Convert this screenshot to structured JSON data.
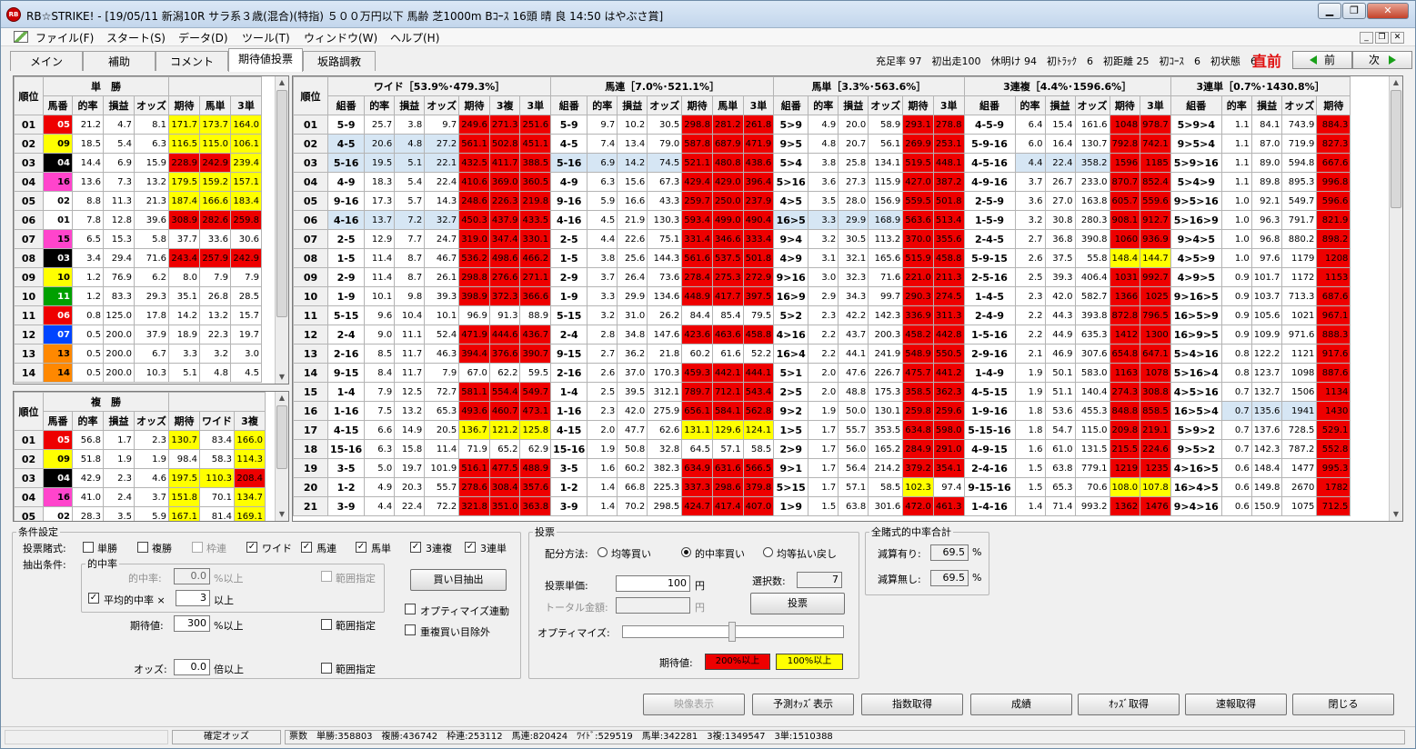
{
  "window": {
    "title": "RB☆STRIKE! - [19/05/11 新潟10R サラ系３歳(混合)(特指) ５００万円以下 馬齢 芝1000m Bｺｰｽ 16頭 晴 良 14:50 はやぶさ賞]",
    "app_icon": "RB",
    "minimize": "▁",
    "restore": "❐",
    "close": "✕"
  },
  "menu": [
    "ファイル(F)",
    "スタート(S)",
    "データ(D)",
    "ツール(T)",
    "ウィンドウ(W)",
    "ヘルプ(H)"
  ],
  "mdi": {
    "minimize": "_",
    "restore": "❐",
    "close": "✕"
  },
  "tabs": [
    "メイン",
    "補助",
    "コメント",
    "期待値投票",
    "坂路調教"
  ],
  "stats": "充足率 97　初出走100　休明け 94　初ﾄﾗｯｸ　6　初距離 25　初ｺｰｽ　6　初状態　6",
  "chokuzen": "直前",
  "prev": "前",
  "next": "次",
  "rank_label": "順位",
  "tansho": {
    "title": "単　勝",
    "cols": [
      "馬番",
      "的率",
      "損益",
      "オッズ",
      "期待",
      "馬単",
      "3単"
    ],
    "rows": [
      [
        "01",
        "05",
        "21.2",
        "4.7",
        "8.1",
        "171.7",
        "173.7",
        "164.0",
        "yyy"
      ],
      [
        "02",
        "09",
        "18.5",
        "5.4",
        "6.3",
        "116.5",
        "115.0",
        "106.1",
        "yyy"
      ],
      [
        "03",
        "04",
        "14.4",
        "6.9",
        "15.9",
        "228.9",
        "242.9",
        "239.4",
        "rry"
      ],
      [
        "04",
        "16",
        "13.6",
        "7.3",
        "13.2",
        "179.5",
        "159.2",
        "157.1",
        "yyy"
      ],
      [
        "05",
        "02",
        "8.8",
        "11.3",
        "21.3",
        "187.4",
        "166.6",
        "183.4",
        "yyy"
      ],
      [
        "06",
        "01",
        "7.8",
        "12.8",
        "39.6",
        "308.9",
        "282.6",
        "259.8",
        "rrr"
      ],
      [
        "07",
        "15",
        "6.5",
        "15.3",
        "5.8",
        "37.7",
        "33.6",
        "30.6",
        "---"
      ],
      [
        "08",
        "03",
        "3.4",
        "29.4",
        "71.6",
        "243.4",
        "257.9",
        "242.9",
        "rrr"
      ],
      [
        "09",
        "10",
        "1.2",
        "76.9",
        "6.2",
        "8.0",
        "7.9",
        "7.9",
        "---"
      ],
      [
        "10",
        "11",
        "1.2",
        "83.3",
        "29.3",
        "35.1",
        "26.8",
        "28.5",
        "---"
      ],
      [
        "11",
        "06",
        "0.8",
        "125.0",
        "17.8",
        "14.2",
        "13.2",
        "15.7",
        "---"
      ],
      [
        "12",
        "07",
        "0.5",
        "200.0",
        "37.9",
        "18.9",
        "22.3",
        "19.7",
        "---"
      ],
      [
        "13",
        "13",
        "0.5",
        "200.0",
        "6.7",
        "3.3",
        "3.2",
        "3.0",
        "---"
      ],
      [
        "14",
        "14",
        "0.5",
        "200.0",
        "10.3",
        "5.1",
        "4.8",
        "4.5",
        "---"
      ]
    ]
  },
  "fukusho": {
    "title": "複　勝",
    "cols": [
      "馬番",
      "的率",
      "損益",
      "オッズ",
      "期待",
      "ワイド",
      "3複"
    ],
    "rows": [
      [
        "01",
        "05",
        "56.8",
        "1.7",
        "2.3",
        "130.7",
        "83.4",
        "166.0",
        "y-y"
      ],
      [
        "02",
        "09",
        "51.8",
        "1.9",
        "1.9",
        "98.4",
        "58.3",
        "114.3",
        "--y"
      ],
      [
        "03",
        "04",
        "42.9",
        "2.3",
        "4.6",
        "197.5",
        "110.3",
        "208.4",
        "yyr"
      ],
      [
        "04",
        "16",
        "41.0",
        "2.4",
        "3.7",
        "151.8",
        "70.1",
        "134.7",
        "y-y"
      ],
      [
        "05",
        "02",
        "28.3",
        "3.5",
        "5.9",
        "167.1",
        "81.4",
        "169.1",
        "y-y"
      ]
    ]
  },
  "right_grid": {
    "sections": [
      {
        "title": "ワイド［53.9%･479.3%］",
        "cols": [
          "組番",
          "的率",
          "損益",
          "オッズ",
          "期待",
          "3複",
          "3単"
        ]
      },
      {
        "title": "馬連［7.0%･521.1%］",
        "cols": [
          "組番",
          "的率",
          "損益",
          "オッズ",
          "期待",
          "馬単",
          "3単"
        ]
      },
      {
        "title": "馬単［3.3%･563.6%］",
        "cols": [
          "組番",
          "的率",
          "損益",
          "オッズ",
          "期待",
          "3単"
        ]
      },
      {
        "title": "3連複［4.4%･1596.6%］",
        "cols": [
          "組番",
          "的率",
          "損益",
          "オッズ",
          "期待",
          "3単"
        ]
      },
      {
        "title": "3連単［0.7%･1430.8%］",
        "cols": [
          "組番",
          "的率",
          "損益",
          "オッズ",
          "期待"
        ]
      }
    ],
    "rows": [
      [
        "01",
        "5-9",
        "25.7",
        "3.8",
        "9.7",
        "249.6",
        "271.3",
        "251.6",
        "5-9",
        "9.7",
        "10.2",
        "30.5",
        "298.8",
        "281.2",
        "261.8",
        "5>9",
        "4.9",
        "20.0",
        "58.9",
        "293.1",
        "278.8",
        "4-5-9",
        "6.4",
        "15.4",
        "161.6",
        "1048",
        "978.7",
        "5>9>4",
        "1.1",
        "84.1",
        "743.9",
        "884.3"
      ],
      [
        "02",
        "4-5",
        "20.6",
        "4.8",
        "27.2",
        "561.1",
        "502.8",
        "451.1",
        "4-5",
        "7.4",
        "13.4",
        "79.0",
        "587.8",
        "687.9",
        "471.9",
        "9>5",
        "4.8",
        "20.7",
        "56.1",
        "269.9",
        "253.1",
        "5-9-16",
        "6.0",
        "16.4",
        "130.7",
        "792.8",
        "742.1",
        "9>5>4",
        "1.1",
        "87.0",
        "719.9",
        "827.3"
      ],
      [
        "03",
        "5-16",
        "19.5",
        "5.1",
        "22.1",
        "432.5",
        "411.7",
        "388.5",
        "5-16",
        "6.9",
        "14.2",
        "74.5",
        "521.1",
        "480.8",
        "438.6",
        "5>4",
        "3.8",
        "25.8",
        "134.1",
        "519.5",
        "448.1",
        "4-5-16",
        "4.4",
        "22.4",
        "358.2",
        "1596",
        "1185",
        "5>9>16",
        "1.1",
        "89.0",
        "594.8",
        "667.6"
      ],
      [
        "04",
        "4-9",
        "18.3",
        "5.4",
        "22.4",
        "410.6",
        "369.0",
        "360.5",
        "4-9",
        "6.3",
        "15.6",
        "67.3",
        "429.4",
        "429.0",
        "396.4",
        "5>16",
        "3.6",
        "27.3",
        "115.9",
        "427.0",
        "387.2",
        "4-9-16",
        "3.7",
        "26.7",
        "233.0",
        "870.7",
        "852.4",
        "5>4>9",
        "1.1",
        "89.8",
        "895.3",
        "996.8"
      ],
      [
        "05",
        "9-16",
        "17.3",
        "5.7",
        "14.3",
        "248.6",
        "226.3",
        "219.8",
        "9-16",
        "5.9",
        "16.6",
        "43.3",
        "259.7",
        "250.0",
        "237.9",
        "4>5",
        "3.5",
        "28.0",
        "156.9",
        "559.5",
        "501.8",
        "2-5-9",
        "3.6",
        "27.0",
        "163.8",
        "605.7",
        "559.6",
        "9>5>16",
        "1.0",
        "92.1",
        "549.7",
        "596.6"
      ],
      [
        "06",
        "4-16",
        "13.7",
        "7.2",
        "32.7",
        "450.3",
        "437.9",
        "433.5",
        "4-16",
        "4.5",
        "21.9",
        "130.3",
        "593.4",
        "499.0",
        "490.4",
        "16>5",
        "3.3",
        "29.9",
        "168.9",
        "563.6",
        "513.4",
        "1-5-9",
        "3.2",
        "30.8",
        "280.3",
        "908.1",
        "912.7",
        "5>16>9",
        "1.0",
        "96.3",
        "791.7",
        "821.9"
      ],
      [
        "07",
        "2-5",
        "12.9",
        "7.7",
        "24.7",
        "319.0",
        "347.4",
        "330.1",
        "2-5",
        "4.4",
        "22.6",
        "75.1",
        "331.4",
        "346.6",
        "333.4",
        "9>4",
        "3.2",
        "30.5",
        "113.2",
        "370.0",
        "355.6",
        "2-4-5",
        "2.7",
        "36.8",
        "390.8",
        "1060",
        "936.9",
        "9>4>5",
        "1.0",
        "96.8",
        "880.2",
        "898.2"
      ],
      [
        "08",
        "1-5",
        "11.4",
        "8.7",
        "46.7",
        "536.2",
        "498.6",
        "466.2",
        "1-5",
        "3.8",
        "25.6",
        "144.3",
        "561.6",
        "537.5",
        "501.8",
        "4>9",
        "3.1",
        "32.1",
        "165.6",
        "515.9",
        "458.8",
        "5-9-15",
        "2.6",
        "37.5",
        "55.8",
        "148.4",
        "144.7",
        "4>5>9",
        "1.0",
        "97.6",
        "1179",
        "1208"
      ],
      [
        "09",
        "2-9",
        "11.4",
        "8.7",
        "26.1",
        "298.8",
        "276.6",
        "271.1",
        "2-9",
        "3.7",
        "26.4",
        "73.6",
        "278.4",
        "275.3",
        "272.9",
        "9>16",
        "3.0",
        "32.3",
        "71.6",
        "221.0",
        "211.3",
        "2-5-16",
        "2.5",
        "39.3",
        "406.4",
        "1031",
        "992.7",
        "4>9>5",
        "0.9",
        "101.7",
        "1172",
        "1153"
      ],
      [
        "10",
        "1-9",
        "10.1",
        "9.8",
        "39.3",
        "398.9",
        "372.3",
        "366.6",
        "1-9",
        "3.3",
        "29.9",
        "134.6",
        "448.9",
        "417.7",
        "397.5",
        "16>9",
        "2.9",
        "34.3",
        "99.7",
        "290.3",
        "274.5",
        "1-4-5",
        "2.3",
        "42.0",
        "582.7",
        "1366",
        "1025",
        "9>16>5",
        "0.9",
        "103.7",
        "713.3",
        "687.6"
      ],
      [
        "11",
        "5-15",
        "9.6",
        "10.4",
        "10.1",
        "96.9",
        "91.3",
        "88.9",
        "5-15",
        "3.2",
        "31.0",
        "26.2",
        "84.4",
        "85.4",
        "79.5",
        "5>2",
        "2.3",
        "42.2",
        "142.3",
        "336.9",
        "311.3",
        "2-4-9",
        "2.2",
        "44.3",
        "393.8",
        "872.8",
        "796.5",
        "16>5>9",
        "0.9",
        "105.6",
        "1021",
        "967.1"
      ],
      [
        "12",
        "2-4",
        "9.0",
        "11.1",
        "52.4",
        "471.9",
        "444.6",
        "436.7",
        "2-4",
        "2.8",
        "34.8",
        "147.6",
        "423.6",
        "463.6",
        "458.8",
        "4>16",
        "2.2",
        "43.7",
        "200.3",
        "458.2",
        "442.8",
        "1-5-16",
        "2.2",
        "44.9",
        "635.3",
        "1412",
        "1300",
        "16>9>5",
        "0.9",
        "109.9",
        "971.6",
        "888.3"
      ],
      [
        "13",
        "2-16",
        "8.5",
        "11.7",
        "46.3",
        "394.4",
        "376.6",
        "390.7",
        "9-15",
        "2.7",
        "36.2",
        "21.8",
        "60.2",
        "61.6",
        "52.2",
        "16>4",
        "2.2",
        "44.1",
        "241.9",
        "548.9",
        "550.5",
        "2-9-16",
        "2.1",
        "46.9",
        "307.6",
        "654.8",
        "647.1",
        "5>4>16",
        "0.8",
        "122.2",
        "1121",
        "917.6"
      ],
      [
        "14",
        "9-15",
        "8.4",
        "11.7",
        "7.9",
        "67.0",
        "62.2",
        "59.5",
        "2-16",
        "2.6",
        "37.0",
        "170.3",
        "459.3",
        "442.1",
        "444.1",
        "5>1",
        "2.0",
        "47.6",
        "226.7",
        "475.7",
        "441.2",
        "1-4-9",
        "1.9",
        "50.1",
        "583.0",
        "1163",
        "1078",
        "5>16>4",
        "0.8",
        "123.7",
        "1098",
        "887.6"
      ],
      [
        "15",
        "1-4",
        "7.9",
        "12.5",
        "72.7",
        "581.1",
        "554.4",
        "549.7",
        "1-4",
        "2.5",
        "39.5",
        "312.1",
        "789.7",
        "712.1",
        "543.4",
        "2>5",
        "2.0",
        "48.8",
        "175.3",
        "358.5",
        "362.3",
        "4-5-15",
        "1.9",
        "51.1",
        "140.4",
        "274.3",
        "308.8",
        "4>5>16",
        "0.7",
        "132.7",
        "1506",
        "1134"
      ],
      [
        "16",
        "1-16",
        "7.5",
        "13.2",
        "65.3",
        "493.6",
        "460.7",
        "473.1",
        "1-16",
        "2.3",
        "42.0",
        "275.9",
        "656.1",
        "584.1",
        "562.8",
        "9>2",
        "1.9",
        "50.0",
        "130.1",
        "259.8",
        "259.6",
        "1-9-16",
        "1.8",
        "53.6",
        "455.3",
        "848.8",
        "858.5",
        "16>5>4",
        "0.7",
        "135.6",
        "1941",
        "1430"
      ],
      [
        "17",
        "4-15",
        "6.6",
        "14.9",
        "20.5",
        "136.7",
        "121.2",
        "125.8",
        "4-15",
        "2.0",
        "47.7",
        "62.6",
        "131.1",
        "129.6",
        "124.1",
        "1>5",
        "1.7",
        "55.7",
        "353.5",
        "634.8",
        "598.0",
        "5-15-16",
        "1.8",
        "54.7",
        "115.0",
        "209.8",
        "219.1",
        "5>9>2",
        "0.7",
        "137.6",
        "728.5",
        "529.1"
      ],
      [
        "18",
        "15-16",
        "6.3",
        "15.8",
        "11.4",
        "71.9",
        "65.2",
        "62.9",
        "15-16",
        "1.9",
        "50.8",
        "32.8",
        "64.5",
        "57.1",
        "58.5",
        "2>9",
        "1.7",
        "56.0",
        "165.2",
        "284.9",
        "291.0",
        "4-9-15",
        "1.6",
        "61.0",
        "131.5",
        "215.5",
        "224.6",
        "9>5>2",
        "0.7",
        "142.3",
        "787.2",
        "552.8"
      ],
      [
        "19",
        "3-5",
        "5.0",
        "19.7",
        "101.9",
        "516.1",
        "477.5",
        "488.9",
        "3-5",
        "1.6",
        "60.2",
        "382.3",
        "634.9",
        "631.6",
        "566.5",
        "9>1",
        "1.7",
        "56.4",
        "214.2",
        "379.2",
        "354.1",
        "2-4-16",
        "1.5",
        "63.8",
        "779.1",
        "1219",
        "1235",
        "4>16>5",
        "0.6",
        "148.4",
        "1477",
        "995.3"
      ],
      [
        "20",
        "1-2",
        "4.9",
        "20.3",
        "55.7",
        "278.6",
        "308.4",
        "357.6",
        "1-2",
        "1.4",
        "66.8",
        "225.3",
        "337.3",
        "298.6",
        "379.8",
        "5>15",
        "1.7",
        "57.1",
        "58.5",
        "102.3",
        "97.4",
        "9-15-16",
        "1.5",
        "65.3",
        "70.6",
        "108.0",
        "107.8",
        "16>4>5",
        "0.6",
        "149.8",
        "2670",
        "1782"
      ],
      [
        "21",
        "3-9",
        "4.4",
        "22.4",
        "72.2",
        "321.8",
        "351.0",
        "363.8",
        "3-9",
        "1.4",
        "70.2",
        "298.5",
        "424.7",
        "417.4",
        "407.0",
        "1>9",
        "1.5",
        "63.8",
        "301.6",
        "472.0",
        "461.3",
        "1-4-16",
        "1.4",
        "71.4",
        "993.2",
        "1362",
        "1476",
        "9>4>16",
        "0.6",
        "150.9",
        "1075",
        "712.5"
      ]
    ]
  },
  "conditions": {
    "title": "条件設定",
    "bet_type_label": "投票賭式:",
    "bets": [
      "単勝",
      "複勝",
      "枠連",
      "ワイド",
      "馬連",
      "馬単",
      "3連複",
      "3連単"
    ],
    "extract_label": "抽出条件:",
    "hit_group": "的中率",
    "hit_rate_label": "的中率:",
    "hit_rate_value": "0.0",
    "hit_rate_unit": "%以上",
    "range1": "範囲指定",
    "avg_label": "平均的中率 ×",
    "avg_value": "3",
    "avg_unit": "以上",
    "buy_button": "買い目抽出",
    "expect_label": "期待値:",
    "expect_value": "300",
    "expect_unit": "%以上",
    "range2": "範囲指定",
    "optimize_link": "オプティマイズ連動",
    "dup_exclude": "重複買い目除外",
    "odds_label": "オッズ:",
    "odds_value": "0.0",
    "odds_unit": "倍以上",
    "range3": "範囲指定",
    "check_mark": "✓"
  },
  "vote": {
    "title": "投票",
    "method_label": "配分方法:",
    "methods": [
      "均等買い",
      "的中率買い",
      "均等払い戻し"
    ],
    "unit_label": "投票単価:",
    "unit_value": "100",
    "yen": "円",
    "count_label": "選択数:",
    "count_value": "7",
    "total_label": "トータル金額:",
    "total_value": "",
    "vote_button": "投票",
    "optimize_label": "オプティマイズ:",
    "expect_label": "期待値:",
    "legend_red": "200%以上",
    "legend_yellow": "100%以上"
  },
  "total": {
    "title": "全賭式的中率合計",
    "with_label": "減算有り:",
    "with_value": "69.5",
    "without_label": "減算無し:",
    "without_value": "69.5",
    "pct": "%"
  },
  "buttons": [
    "映像表示",
    "予測ｵｯｽﾞ表示",
    "指数取得",
    "成績",
    "ｵｯｽﾞ取得",
    "速報取得",
    "閉じる"
  ],
  "status": {
    "left": "確定オッズ",
    "right": "票数　単勝:358803　複勝:436742　枠連:253112　馬連:820424　ﾜｲﾄﾞ:529519　馬単:342281　3複:1349547　3単:1510388"
  },
  "colors": {
    "red": "#ee0000",
    "yellow": "#ffff00",
    "highlight": "#d6e6f4",
    "frame": [
      "#ffffff",
      "#000000",
      "#ee0000",
      "#0044ff",
      "#ffff00",
      "#00a000",
      "#ff8800",
      "#ff44cc"
    ]
  },
  "horse_frame": {
    "01": 0,
    "02": 0,
    "03": 1,
    "04": 1,
    "05": 2,
    "06": 2,
    "07": 3,
    "08": 3,
    "09": 4,
    "10": 4,
    "11": 5,
    "12": 5,
    "13": 6,
    "14": 6,
    "15": 7,
    "16": 7
  }
}
